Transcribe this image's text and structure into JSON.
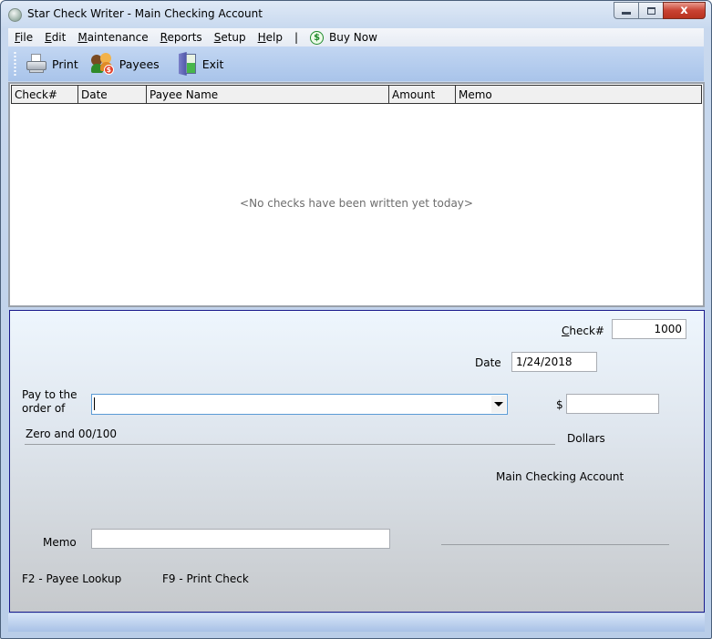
{
  "window": {
    "title": "Star Check Writer - Main Checking Account",
    "controls": {
      "minimize": "minimize",
      "maximize": "maximize",
      "close": "x"
    }
  },
  "menu": {
    "items": [
      {
        "label": "File",
        "accel": "F"
      },
      {
        "label": "Edit",
        "accel": "E"
      },
      {
        "label": "Maintenance",
        "accel": "M"
      },
      {
        "label": "Reports",
        "accel": "R"
      },
      {
        "label": "Setup",
        "accel": "S"
      },
      {
        "label": "Help",
        "accel": "H"
      }
    ],
    "separator": "|",
    "buy_now": {
      "label": "Buy Now",
      "icon": "dollar-circle-icon",
      "icon_glyph": "$"
    }
  },
  "toolbar": {
    "print": {
      "label": "Print",
      "icon": "printer-icon"
    },
    "payees": {
      "label": "Payees",
      "icon": "payees-icon",
      "coin_glyph": "$"
    },
    "exit": {
      "label": "Exit",
      "icon": "exit-door-icon"
    }
  },
  "checks_list": {
    "columns": [
      "Check#",
      "Date",
      "Payee Name",
      "Amount",
      "Memo"
    ],
    "rows": [],
    "empty_message": "<No checks have been written yet today>"
  },
  "check_form": {
    "check_number_label": "Check#",
    "check_number": "1000",
    "date_label": "Date",
    "date": "1/24/2018",
    "pay_to_label_line1": "Pay to the",
    "pay_to_label_line2": "order of",
    "payee_value": "",
    "dollar_sign": "$",
    "amount_value": "",
    "amount_words": "Zero and 00/100",
    "dollars_label": "Dollars",
    "account_name": "Main Checking Account",
    "memo_label": "Memo",
    "memo_value": "",
    "shortcut_payee_lookup": "F2 - Payee Lookup",
    "shortcut_print_check": "F9 - Print Check"
  }
}
